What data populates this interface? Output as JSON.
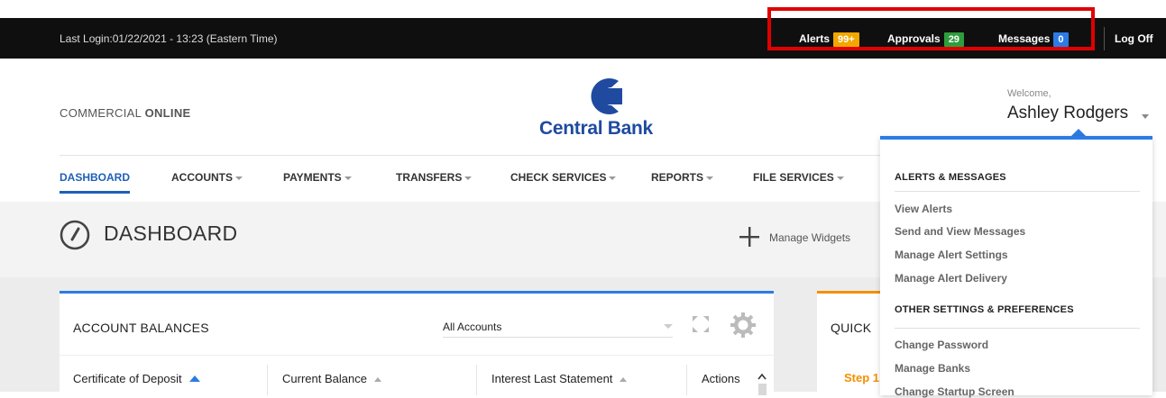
{
  "topbar": {
    "last_login": "Last Login:01/22/2021 - 13:23 (Eastern Time)",
    "alerts_label": "Alerts",
    "alerts_count": "99+",
    "approvals_label": "Approvals",
    "approvals_count": "29",
    "messages_label": "Messages",
    "messages_count": "0",
    "logoff_label": "Log Off"
  },
  "header": {
    "brand_light": "COMMERCIAL ",
    "brand_bold": "ONLINE",
    "logo_text": "Central Bank",
    "welcome": "Welcome,",
    "username": "Ashley Rodgers"
  },
  "nav": {
    "items": [
      "DASHBOARD",
      "ACCOUNTS",
      "PAYMENTS",
      "TRANSFERS",
      "CHECK SERVICES",
      "REPORTS",
      "FILE SERVICES"
    ]
  },
  "page": {
    "title": "DASHBOARD",
    "manage_widgets": "Manage Widgets"
  },
  "account_balances": {
    "title": "ACCOUNT BALANCES",
    "filter_value": "All Accounts",
    "columns": [
      "Certificate of Deposit",
      "Current Balance",
      "Interest Last Statement",
      "Actions"
    ]
  },
  "quick": {
    "title": "QUICK",
    "step": "Step 1"
  },
  "user_menu": {
    "alerts_heading": "ALERTS & MESSAGES",
    "alerts_items": [
      "View Alerts",
      "Send and View Messages",
      "Manage Alert Settings",
      "Manage Alert Delivery"
    ],
    "other_heading": "OTHER SETTINGS & PREFERENCES",
    "other_items": [
      "Change Password",
      "Manage Banks",
      "Change Startup Screen"
    ]
  },
  "colors": {
    "accent_blue": "#2c7be5",
    "brand_blue": "#1f4aa0",
    "alert_yellow": "#f2a600",
    "approval_green": "#2e9d3c",
    "highlight_red": "#e00000",
    "quick_orange": "#f29000"
  }
}
